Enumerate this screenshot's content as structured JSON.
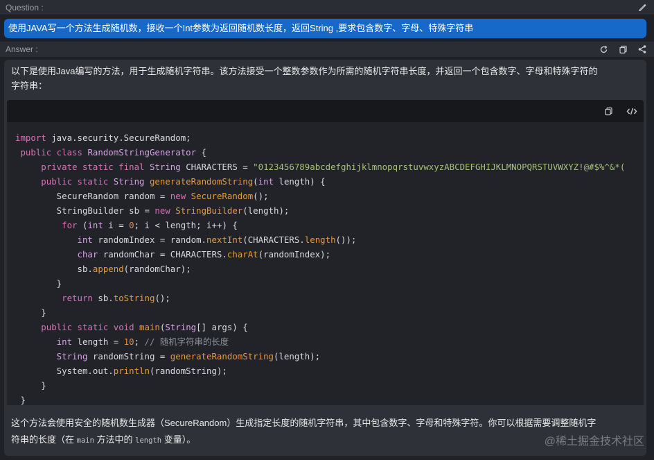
{
  "question": {
    "label": "Question :",
    "text": "使用JAVA写一个方法生成随机数，接收一个Int参数为返回随机数长度，返回String ,要求包含数字、字母、特殊字符串"
  },
  "answer": {
    "label": "Answer :",
    "intro_line1": "以下是使用Java编写的方法，用于生成随机字符串。该方法接受一个整数参数作为所需的随机字符串长度，并返回一个包含数字、字母和特殊字符的",
    "intro_line2": "字符串：",
    "outro_line1": "这个方法会使用安全的随机数生成器（SecureRandom）生成指定长度的随机字符串，其中包含数字、字母和特殊字符。你可以根据需要调整随机字",
    "outro_line2_a": "符串的长度（在 ",
    "outro_line2_code1": "main",
    "outro_line2_b": " 方法中的 ",
    "outro_line2_code2": "length",
    "outro_line2_c": " 变量）。"
  },
  "code_lines": [
    [
      [
        "kw",
        "import"
      ],
      [
        "pl",
        " java.security.SecureRandom;"
      ]
    ],
    [
      [
        "kw",
        " public class "
      ],
      [
        "cl",
        "RandomStringGenerator"
      ],
      [
        "pl",
        " {"
      ]
    ],
    [
      [
        "kw",
        "     private static final "
      ],
      [
        "ty",
        "String"
      ],
      [
        "pl",
        " CHARACTERS = "
      ],
      [
        "st",
        "\"0123456789abcdefghijklmnopqrstuvwxyzABCDEFGHIJKLMNOPQRSTUVWXYZ!@#$%^&*("
      ]
    ],
    [
      [
        "kw",
        "     public static "
      ],
      [
        "ty",
        "String "
      ],
      [
        "fn",
        "generateRandomString"
      ],
      [
        "pl",
        "("
      ],
      [
        "ty",
        "int"
      ],
      [
        "pl",
        " length) {"
      ]
    ],
    [
      [
        "pl",
        "        SecureRandom random = "
      ],
      [
        "kw",
        "new "
      ],
      [
        "fn",
        "SecureRandom"
      ],
      [
        "pl",
        "();"
      ]
    ],
    [
      [
        "pl",
        "        StringBuilder sb = "
      ],
      [
        "kw",
        "new "
      ],
      [
        "fn",
        "StringBuilder"
      ],
      [
        "pl",
        "(length);"
      ]
    ],
    [
      [
        "kw",
        "         for"
      ],
      [
        "pl",
        " ("
      ],
      [
        "ty",
        "int"
      ],
      [
        "pl",
        " i = "
      ],
      [
        "nm",
        "0"
      ],
      [
        "pl",
        "; i < length; i++) {"
      ]
    ],
    [
      [
        "ty",
        "            int"
      ],
      [
        "pl",
        " randomIndex = random."
      ],
      [
        "fn",
        "nextInt"
      ],
      [
        "pl",
        "(CHARACTERS."
      ],
      [
        "fn",
        "length"
      ],
      [
        "pl",
        "());"
      ]
    ],
    [
      [
        "ty",
        "            char"
      ],
      [
        "pl",
        " randomChar = CHARACTERS."
      ],
      [
        "fn",
        "charAt"
      ],
      [
        "pl",
        "(randomIndex);"
      ]
    ],
    [
      [
        "pl",
        "            sb."
      ],
      [
        "fn",
        "append"
      ],
      [
        "pl",
        "(randomChar);"
      ]
    ],
    [
      [
        "pl",
        "        }"
      ]
    ],
    [
      [
        "kw",
        "         return"
      ],
      [
        "pl",
        " sb."
      ],
      [
        "fn",
        "toString"
      ],
      [
        "pl",
        "();"
      ]
    ],
    [
      [
        "pl",
        "     }"
      ]
    ],
    [
      [
        "kw",
        "     public static void "
      ],
      [
        "fn",
        "main"
      ],
      [
        "pl",
        "("
      ],
      [
        "ty",
        "String"
      ],
      [
        "pl",
        "[] args) {"
      ]
    ],
    [
      [
        "ty",
        "        int"
      ],
      [
        "pl",
        " length = "
      ],
      [
        "nm",
        "10"
      ],
      [
        "pl",
        "; "
      ],
      [
        "cm",
        "// 随机字符串的长度"
      ]
    ],
    [
      [
        "ty",
        "        String"
      ],
      [
        "pl",
        " randomString = "
      ],
      [
        "fn",
        "generateRandomString"
      ],
      [
        "pl",
        "(length);"
      ]
    ],
    [
      [
        "pl",
        "        System.out."
      ],
      [
        "fn",
        "println"
      ],
      [
        "pl",
        "(randomString);"
      ]
    ],
    [
      [
        "pl",
        "     }"
      ]
    ],
    [
      [
        "pl",
        " }"
      ]
    ]
  ],
  "watermark": "@稀土掘金技术社区",
  "icons": {
    "edit": "pencil-icon",
    "regenerate": "refresh-icon",
    "copy": "copy-icon",
    "share": "share-icon",
    "code_copy": "copy-icon",
    "code_view": "code-icon"
  },
  "colors": {
    "question_bg": "#1769c9",
    "panel_bg": "#2e3138",
    "code_bg": "#212328"
  }
}
